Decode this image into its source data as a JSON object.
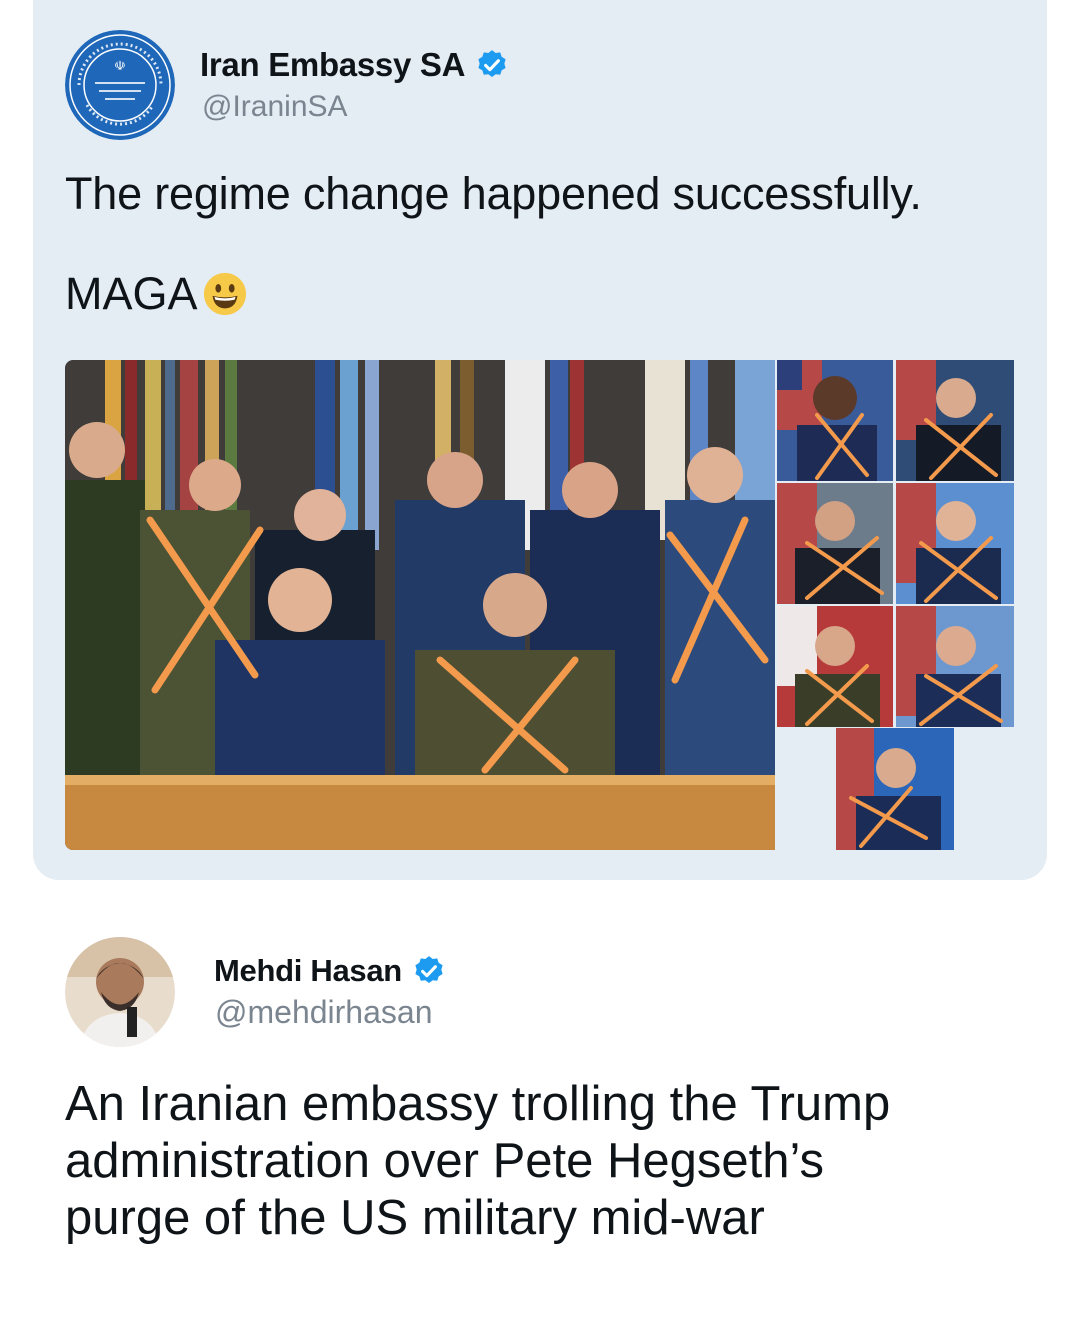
{
  "quoted_tweet": {
    "display_name": "Iran Embassy SA",
    "handle": "@IraninSA",
    "text_line_1": "The regime change happened successfully.",
    "text_line_2": "MAGA",
    "emoji": "grinning-face-emoji",
    "verified": true
  },
  "reply_tweet": {
    "display_name": "Mehdi Hasan",
    "handle": "@mehdirhasan",
    "text_lines": [
      "An Iranian embassy trolling the Trump",
      "administration over Pete Hegseth’s",
      "purge of the US military mid-war"
    ],
    "verified": true
  },
  "colors": {
    "quote_background": "#e4ecf4",
    "verified_blue": "#1d9bf0",
    "handle_gray": "#7b8590",
    "cross_orange": "#f39a4c",
    "seal_blue": "#1f67b8"
  },
  "icons": {
    "verified": "verified-badge-icon",
    "seal": "embassy-seal-logo"
  }
}
